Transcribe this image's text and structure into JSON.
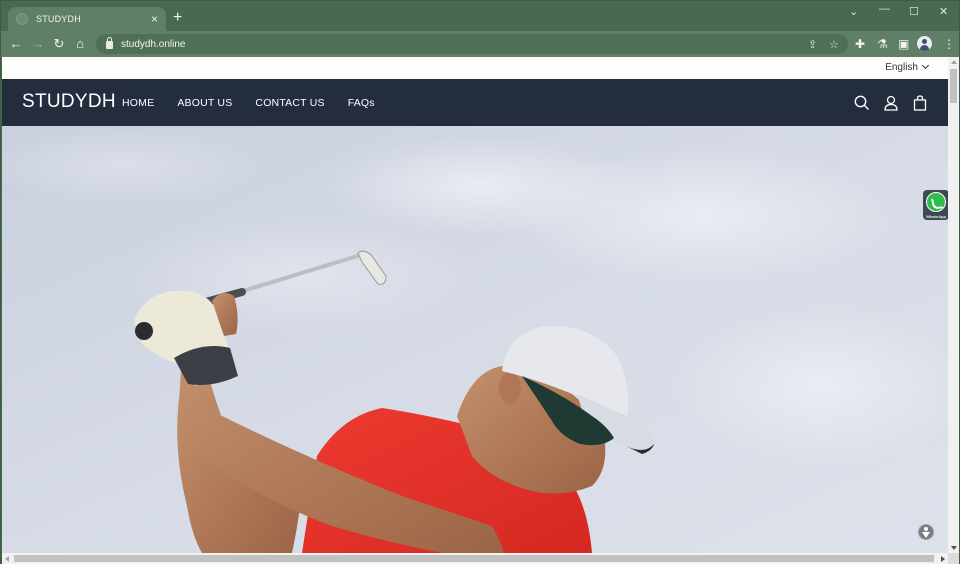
{
  "browser": {
    "tab": {
      "title": "STUDYDH",
      "close_icon": "close-icon"
    },
    "new_tab_icon": "plus-icon",
    "window_controls": {
      "tab_search": "chevron-down-icon",
      "minimize": "minimize-icon",
      "maximize": "maximize-icon",
      "close": "close-icon"
    },
    "nav": {
      "back": "arrow-left-icon",
      "forward": "arrow-right-icon",
      "reload": "reload-icon",
      "home": "home-icon"
    },
    "address_bar": {
      "url": "studydh.online",
      "security": "lock-icon"
    },
    "toolbar_icons": [
      "share-icon",
      "star-icon",
      "extensions-icon",
      "labs-icon",
      "side-panel-icon",
      "profile-avatar",
      "menu-dots-icon"
    ]
  },
  "site": {
    "language": {
      "selected": "English"
    },
    "header": {
      "logo": "STUDYDH",
      "nav": [
        {
          "label": "HOME"
        },
        {
          "label": "ABOUT US"
        },
        {
          "label": "CONTACT US"
        },
        {
          "label": "FAQs"
        }
      ],
      "icons": [
        "search-icon",
        "account-icon",
        "cart-icon"
      ]
    },
    "hero": {
      "image": "golfer-swinging-club-against-cloudy-sky",
      "colors": {
        "sky": "#d4d9e4",
        "shirt": "#e2332c",
        "cap": "#e6e8ee",
        "skin": "#b77e5d"
      }
    },
    "floating": {
      "whatsapp": {
        "label": "WhatsApp"
      },
      "accessibility": "accessibility-icon"
    }
  },
  "theme": {
    "browser_frame": "#4a6a50",
    "browser_toolbar": "#5f8066",
    "site_header": "#232d3e",
    "whatsapp_green": "#2fbd4e"
  }
}
